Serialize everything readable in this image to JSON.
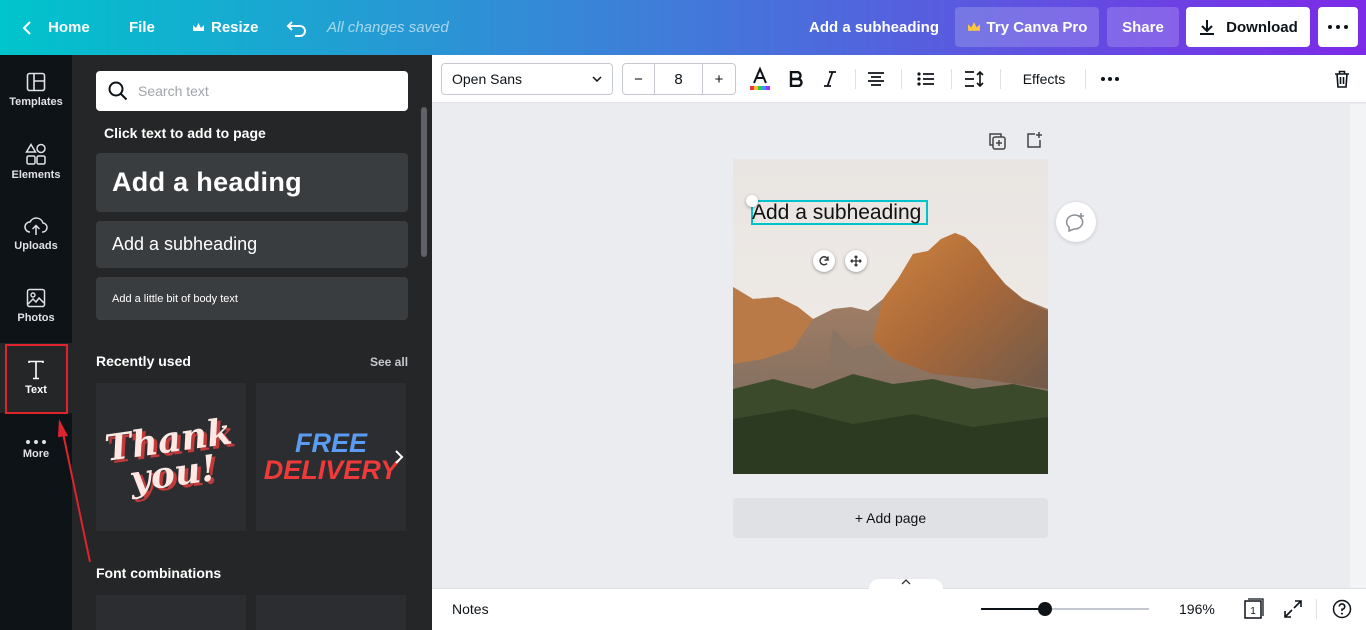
{
  "topbar": {
    "home_label": "Home",
    "file_label": "File",
    "resize_label": "Resize",
    "saved_status": "All changes saved",
    "doc_title": "Add a subheading",
    "try_pro_label": "Try Canva Pro",
    "share_label": "Share",
    "download_label": "Download"
  },
  "rail": {
    "items": [
      {
        "label": "Templates",
        "icon": "templates-icon"
      },
      {
        "label": "Elements",
        "icon": "elements-icon"
      },
      {
        "label": "Uploads",
        "icon": "uploads-icon"
      },
      {
        "label": "Photos",
        "icon": "photos-icon"
      },
      {
        "label": "Text",
        "icon": "text-icon"
      },
      {
        "label": "More",
        "icon": "more-icon"
      }
    ],
    "active": "Text"
  },
  "panel": {
    "search_placeholder": "Search text",
    "click_hint": "Click text to add to page",
    "heading_label": "Add a heading",
    "subheading_label": "Add a subheading",
    "body_label": "Add a little bit of body text",
    "recently_used_title": "Recently used",
    "see_all_label": "See all",
    "thumb1_line1": "Thank",
    "thumb1_line2": "you!",
    "thumb2_line1": "FREE",
    "thumb2_line2": "DELIVERY",
    "font_combinations_title": "Font combinations"
  },
  "toolbar": {
    "font_family": "Open Sans",
    "font_size": "8",
    "minus_label": "−",
    "plus_label": "+",
    "effects_label": "Effects"
  },
  "canvas": {
    "selected_text": "Add a subheading",
    "add_page_label": "+ Add page"
  },
  "bottombar": {
    "notes_label": "Notes",
    "zoom_value": "196%",
    "zoom_fraction": 0.38,
    "page_count": "1"
  },
  "colors": {
    "gradient_start": "#00c4cc",
    "gradient_end": "#7d2ae8",
    "selection": "#00c4cc",
    "annotation": "#e0242d",
    "crown": "#ffc83d"
  }
}
